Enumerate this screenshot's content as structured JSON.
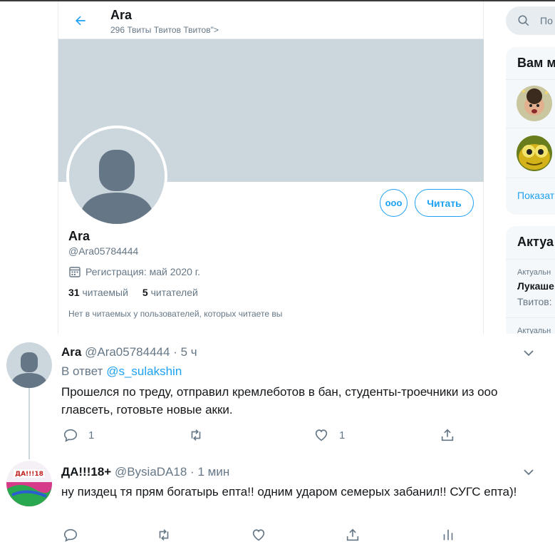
{
  "header": {
    "name": "Ara",
    "tweet_count": "296 Твиты Твитов Твитов\">"
  },
  "profile": {
    "name": "Ara",
    "handle": "@Ara05784444",
    "joined": "Регистрация: май 2020 г.",
    "following_count": "31",
    "following_label": "читаемый",
    "followers_count": "5",
    "followers_label": "читателей",
    "mutual_note": "Нет в читаемых у пользователей, которых читаете вы",
    "more_label": "ooo",
    "follow_label": "Читать"
  },
  "sidebar": {
    "search_placeholder": "По",
    "who_to_follow_title": "Вам м",
    "show_more": "Показат",
    "trends_title": "Актуа",
    "trend1_meta": "Актуальн",
    "trend1_name": "Лукаше",
    "trend1_count": "Твитов:",
    "trend2_meta": "Актуальн"
  },
  "tweets": [
    {
      "name": "Ara",
      "handle": "@Ara05784444",
      "sep": "·",
      "time": "5 ч",
      "reply_prefix": "В ответ",
      "reply_to": "@s_sulakshin",
      "text": "Прошелся по треду, отправил кремлеботов в бан, студенты-троечники из ооо главсеть, готовьте новые акки.",
      "replies": "1",
      "likes": "1"
    },
    {
      "name": "ДА!!!18+",
      "handle": "@BysiaDA18",
      "sep": "·",
      "time": "1 мин",
      "text": "ну пиздец тя прям богатырь епта!! одним ударом семерых забанил!! СУГС епта)!"
    }
  ],
  "colors": {
    "accent": "#1da1f2",
    "banner": "#ccd6dd",
    "secondary_text": "#657786"
  }
}
